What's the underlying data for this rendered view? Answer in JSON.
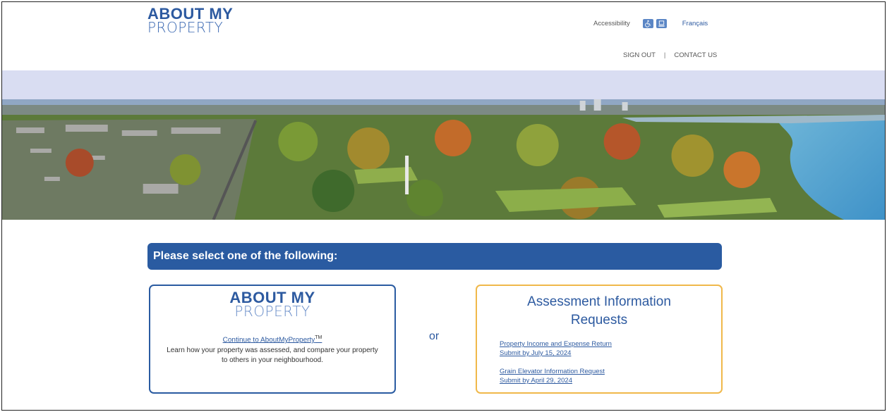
{
  "header": {
    "logo_line1": "ABOUT MY",
    "logo_line2": "PROPERTY",
    "accessibility_label": "Accessibility",
    "language_label": "Français",
    "nav": {
      "sign_out": "SIGN OUT",
      "separator": "|",
      "contact_us": "CONTACT US"
    }
  },
  "banner": {
    "icon": "aerial-landscape-image"
  },
  "main": {
    "select_heading": "Please select one of the following:",
    "or_label": "or",
    "amp_card": {
      "logo_line1": "ABOUT MY",
      "logo_line2": "PROPERTY",
      "link_label": "Continue to AboutMyProperty",
      "trademark": "TM",
      "description": "Learn how your property was assessed, and compare your property to others in your neighbourhood."
    },
    "ari_card": {
      "title_line1": "Assessment Information",
      "title_line2": "Requests",
      "items": [
        {
          "label": "Property Income and Expense Return",
          "deadline": "Submit by July 15, 2024"
        },
        {
          "label": "Grain Elevator Information Request",
          "deadline": "Submit by April 29, 2024"
        }
      ]
    }
  },
  "colors": {
    "brand_blue": "#2a5ba1",
    "band_lavender": "#d9ddf2",
    "accent_gold": "#f0b84a"
  }
}
